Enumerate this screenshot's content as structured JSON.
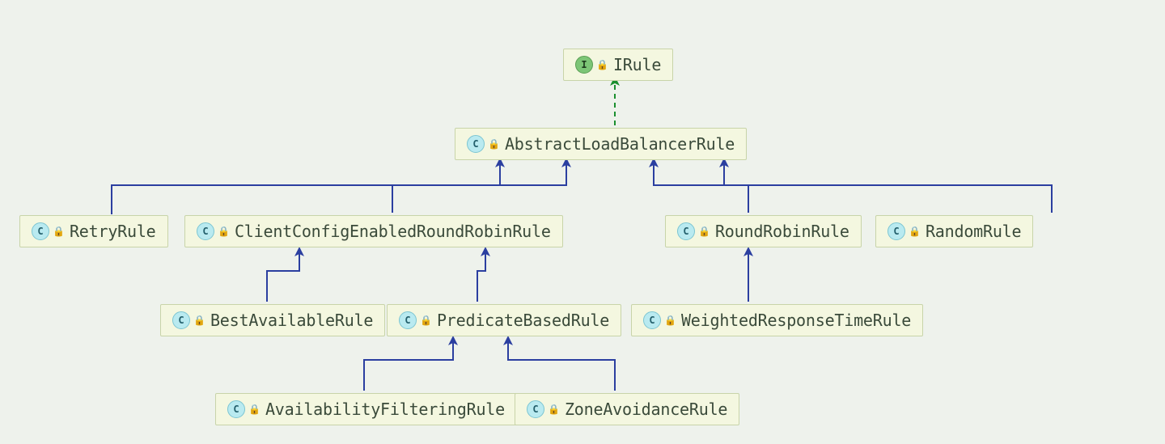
{
  "diagram": {
    "root_interface": "IRule",
    "nodes": {
      "irule": {
        "type": "interface",
        "label": "IRule"
      },
      "abstract": {
        "type": "class",
        "label": "AbstractLoadBalancerRule"
      },
      "retry": {
        "type": "class",
        "label": "RetryRule"
      },
      "clientconfig": {
        "type": "class",
        "label": "ClientConfigEnabledRoundRobinRule"
      },
      "roundrobin": {
        "type": "class",
        "label": "RoundRobinRule"
      },
      "random": {
        "type": "class",
        "label": "RandomRule"
      },
      "bestavailable": {
        "type": "class",
        "label": "BestAvailableRule"
      },
      "predicatebased": {
        "type": "class",
        "label": "PredicateBasedRule"
      },
      "weightedresponse": {
        "type": "class",
        "label": "WeightedResponseTimeRule"
      },
      "availabilityfilter": {
        "type": "class",
        "label": "AvailabilityFilteringRule"
      },
      "zoneavoidance": {
        "type": "class",
        "label": "ZoneAvoidanceRule"
      }
    },
    "edges": [
      {
        "from": "abstract",
        "to": "irule",
        "style": "dashed"
      },
      {
        "from": "retry",
        "to": "abstract",
        "style": "solid"
      },
      {
        "from": "clientconfig",
        "to": "abstract",
        "style": "solid"
      },
      {
        "from": "roundrobin",
        "to": "abstract",
        "style": "solid"
      },
      {
        "from": "random",
        "to": "abstract",
        "style": "solid"
      },
      {
        "from": "bestavailable",
        "to": "clientconfig",
        "style": "solid"
      },
      {
        "from": "predicatebased",
        "to": "clientconfig",
        "style": "solid"
      },
      {
        "from": "weightedresponse",
        "to": "roundrobin",
        "style": "solid"
      },
      {
        "from": "availabilityfilter",
        "to": "predicatebased",
        "style": "solid"
      },
      {
        "from": "zoneavoidance",
        "to": "predicatebased",
        "style": "solid"
      }
    ],
    "icon_letters": {
      "interface": "I",
      "class": "C"
    },
    "lock_glyph": "🔒"
  }
}
